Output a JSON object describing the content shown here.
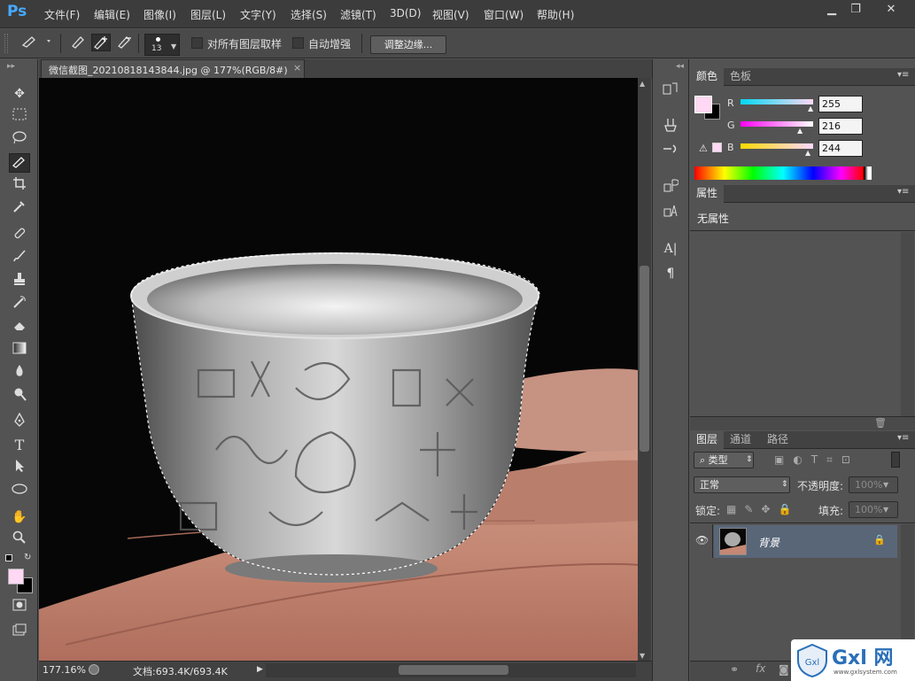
{
  "app": {
    "logo": "Ps"
  },
  "menu": [
    "文件(F)",
    "编辑(E)",
    "图像(I)",
    "图层(L)",
    "文字(Y)",
    "选择(S)",
    "滤镜(T)",
    "3D(D)",
    "视图(V)",
    "窗口(W)",
    "帮助(H)"
  ],
  "window_controls": {
    "minimize": "▁",
    "maximize": "❐",
    "close": "✕"
  },
  "options": {
    "brush_size": "13",
    "sample_all_layers": "对所有图层取样",
    "auto_enhance": "自动增强",
    "refine_edge": "调整边缘..."
  },
  "document": {
    "tab_title": "微信截图_20210818143844.jpg @ 177%(RGB/8#)",
    "close": "×",
    "zoom": "177.16%",
    "doc_info": "文档:693.4K/693.4K"
  },
  "color_panel": {
    "tabs": [
      "颜色",
      "色板"
    ],
    "r_label": "R",
    "g_label": "G",
    "b_label": "B",
    "r": "255",
    "g": "216",
    "b": "244",
    "fg_color": "#ffd8f4",
    "bg_color": "#000000"
  },
  "properties_panel": {
    "title": "属性",
    "content": "无属性"
  },
  "layers_panel": {
    "tabs": [
      "图层",
      "通道",
      "路径"
    ],
    "filter_kind": "类型",
    "blend_mode": "正常",
    "opacity_label": "不透明度:",
    "opacity": "100%",
    "lock_label": "锁定:",
    "fill_label": "填充:",
    "fill": "100%",
    "layer_name": "背景"
  },
  "watermark": {
    "text": "Gxl 网",
    "url": "www.gxlsystem.com"
  }
}
